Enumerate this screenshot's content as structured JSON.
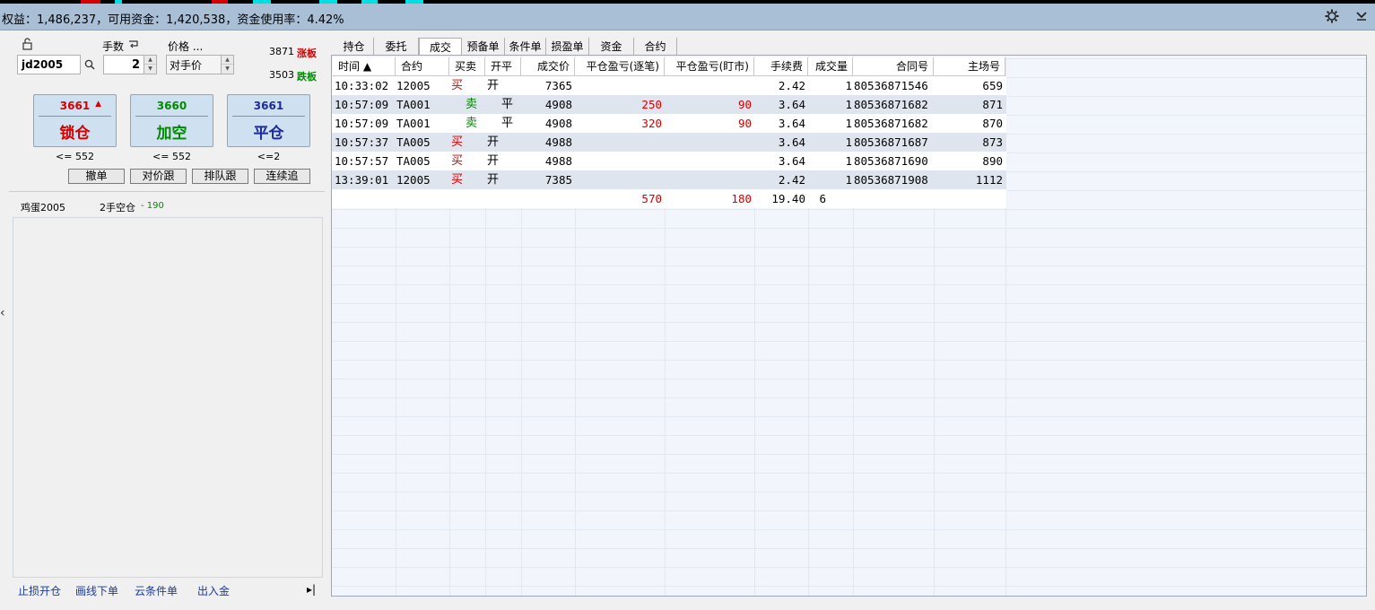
{
  "statusbar": {
    "text": "权益：1,486,237，可用资金：1,420,538，资金使用率：4.42%",
    "settings_icon": "gear-icon",
    "menu_icon": "chevron-down-icon"
  },
  "order_panel": {
    "lock_icon": "unlock-icon",
    "qty_label": "手数",
    "qty_toggle_icon": "return-arrow-icon",
    "price_label": "价格 ...",
    "symbol": "jd2005",
    "search_icon": "search-icon",
    "qty_value": "2",
    "price_value": "对手价",
    "limit_up_price": "3871",
    "limit_up_label": "涨板",
    "limit_down_price": "3503",
    "limit_down_label": "跌板",
    "buttons": [
      {
        "price": "3661",
        "label": "锁仓",
        "sub": "<= 552",
        "arrow": "▲"
      },
      {
        "price": "3660",
        "label": "加空",
        "sub": "<= 552"
      },
      {
        "price": "3661",
        "label": "平仓",
        "sub": "<=2"
      }
    ],
    "small_buttons": [
      "撤单",
      "对价跟",
      "排队跟",
      "连续追"
    ],
    "position": {
      "name": "鸡蛋2005",
      "desc": "2手空仓",
      "pnl": "- 190"
    },
    "links": [
      "止损开仓",
      "画线下单",
      "云条件单",
      "出入金"
    ],
    "expand_icon": "▸|"
  },
  "tabs": [
    "持仓",
    "委托",
    "成交",
    "预备单",
    "条件单",
    "损盈单",
    "资金",
    "合约"
  ],
  "active_tab": "成交",
  "table": {
    "headers": [
      "时间 ▲",
      "合约",
      "买卖",
      "开平",
      "成交价",
      "平仓盈亏(逐笔)",
      "平仓盈亏(盯市)",
      "手续费",
      "成交量",
      "合同号",
      "主场号"
    ],
    "rows": [
      {
        "time": "10:33:02",
        "contract": "12005",
        "side": "买",
        "oc": "开",
        "price": "7365",
        "pnl1": "",
        "pnl2": "",
        "fee": "2.42",
        "qty": "1",
        "order": "80536871546",
        "seq": "659"
      },
      {
        "time": "10:57:09",
        "contract": "TA001",
        "side": "卖",
        "oc": "平",
        "price": "4908",
        "pnl1": "250",
        "pnl2": "90",
        "fee": "3.64",
        "qty": "1",
        "order": "80536871682",
        "seq": "871"
      },
      {
        "time": "10:57:09",
        "contract": "TA001",
        "side": "卖",
        "oc": "平",
        "price": "4908",
        "pnl1": "320",
        "pnl2": "90",
        "fee": "3.64",
        "qty": "1",
        "order": "80536871682",
        "seq": "870"
      },
      {
        "time": "10:57:37",
        "contract": "TA005",
        "side": "买",
        "oc": "开",
        "price": "4988",
        "pnl1": "",
        "pnl2": "",
        "fee": "3.64",
        "qty": "1",
        "order": "80536871687",
        "seq": "873"
      },
      {
        "time": "10:57:57",
        "contract": "TA005",
        "side": "买",
        "oc": "开",
        "price": "4988",
        "pnl1": "",
        "pnl2": "",
        "fee": "3.64",
        "qty": "1",
        "order": "80536871690",
        "seq": "890"
      },
      {
        "time": "13:39:01",
        "contract": "12005",
        "side": "买",
        "oc": "开",
        "price": "7385",
        "pnl1": "",
        "pnl2": "",
        "fee": "2.42",
        "qty": "1",
        "order": "80536871908",
        "seq": "1112"
      }
    ],
    "totals": {
      "pnl1": "570",
      "pnl2": "180",
      "fee": "19.40",
      "qty": "6"
    }
  },
  "colors": {
    "buy": "#d40000",
    "sell": "#008a00",
    "status_bg": "#a9bfd6"
  }
}
